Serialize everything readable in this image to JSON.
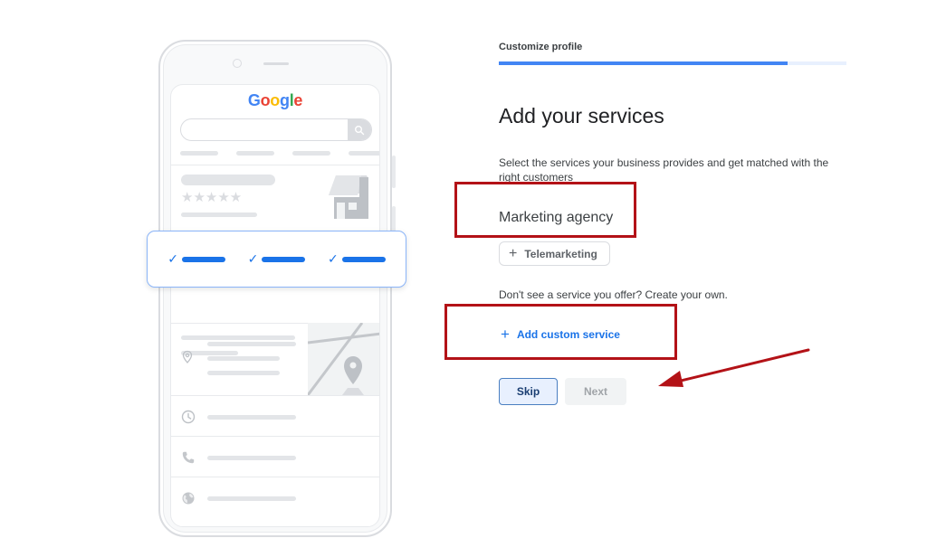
{
  "phone_illustration": {
    "logo_letters": [
      "G",
      "o",
      "o",
      "g",
      "l",
      "e"
    ],
    "icons": [
      "search-icon",
      "storefront-icon",
      "star-icon",
      "chevron-right-icon",
      "location-pin-icon",
      "map-pin-icon",
      "clock-icon",
      "phone-icon",
      "globe-icon",
      "checkmark-icon"
    ],
    "rating_stars": "★★★★★",
    "chevron": "›",
    "check_mark": "✓",
    "check_items_count": 3
  },
  "header": {
    "step_label": "Customize profile",
    "progress_percent": 83
  },
  "main": {
    "title": "Add your services",
    "description": "Select the services your business provides and get matched with the right customers",
    "category_name": "Marketing agency",
    "suggested_services": [
      {
        "label": "Telemarketing",
        "icon": "+"
      }
    ],
    "custom_hint": "Don't see a service you offer? Create your own.",
    "add_custom": {
      "label": "Add custom service",
      "icon": "+"
    }
  },
  "actions": {
    "skip_label": "Skip",
    "next_label": "Next",
    "next_disabled": true
  },
  "annotations": {
    "color": "#b31217",
    "highlight_boxes": [
      "category-name",
      "add-custom-service"
    ],
    "arrow_target": "skip-next-buttons"
  },
  "colors": {
    "accent": "#1a73e8",
    "progress_fill": "#4285f4",
    "progress_track": "#e8f0fe",
    "annotation_red": "#b31217"
  }
}
